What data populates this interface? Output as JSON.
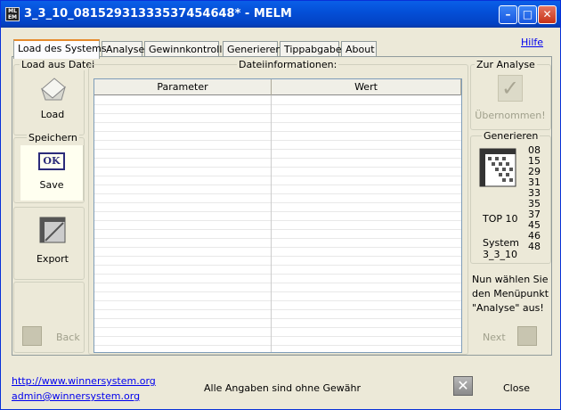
{
  "window": {
    "title": "3_3_10_08152931333537454648* - MELM"
  },
  "tabs": [
    "Load des Systems",
    "Analyse",
    "Gewinnkontrolle",
    "Generieren",
    "Tippabgabe",
    "About"
  ],
  "help": "Hilfe",
  "left": {
    "load_group": "Load aus Datei",
    "load_label": "Load",
    "save_group": "Speichern",
    "save_label": "Save",
    "ok_text": "OK",
    "export_label": "Export",
    "back_label": "Back"
  },
  "center": {
    "group": "Dateiinformationen:",
    "columns": [
      "Parameter",
      "Wert"
    ]
  },
  "right": {
    "analyse_group": "Zur Analyse",
    "uebernommen": "Übernommen!",
    "generieren_group": "Generieren",
    "numbers": [
      "08",
      "15",
      "29",
      "31",
      "33",
      "35",
      "37",
      "45",
      "46",
      "48"
    ],
    "top": "TOP 10",
    "system": "System",
    "system_name": "3_3_10",
    "hint_lines": [
      "Nun wählen Sie",
      "den Menüpunkt",
      "\"Analyse\" aus!"
    ],
    "next_label": "Next"
  },
  "footer": {
    "url": "http://www.winnersystem.org",
    "email": "admin@winnersystem.org",
    "disclaimer": "Alle Angaben sind ohne Gewähr",
    "close": "Close"
  }
}
